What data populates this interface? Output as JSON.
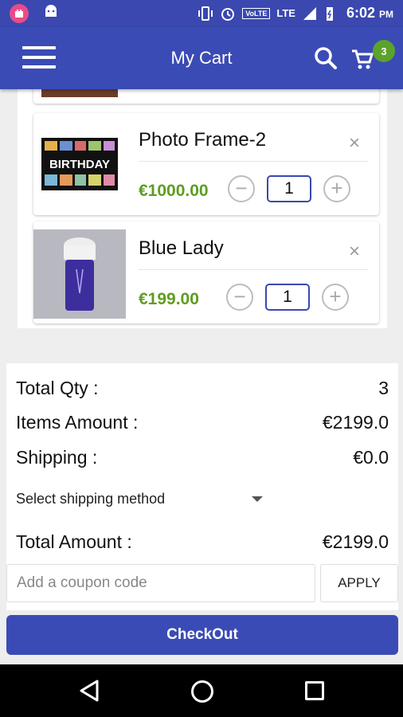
{
  "status_bar": {
    "network": "LTE",
    "volte": "VoLTE",
    "time": "6:02",
    "ampm": "PM"
  },
  "toolbar": {
    "title": "My Cart",
    "cart_count": "3"
  },
  "items": [
    {
      "name": "Photo Frame-2",
      "price": "€1000.00",
      "qty": "1",
      "remove": "×",
      "minus": "−",
      "plus": "+",
      "thumb_text": "BIRTHDAY"
    },
    {
      "name": "Blue Lady",
      "price": "€199.00",
      "qty": "1",
      "remove": "×",
      "minus": "−",
      "plus": "+"
    }
  ],
  "summary": {
    "total_qty_label": "Total Qty :",
    "total_qty": "3",
    "items_amount_label": "Items Amount :",
    "items_amount": "€2199.0",
    "shipping_label": "Shipping :",
    "shipping": "€0.0",
    "shipping_method_placeholder": "Select shipping method",
    "total_amount_label": "Total Amount :",
    "total_amount": "€2199.0"
  },
  "coupon": {
    "placeholder": "Add a coupon code",
    "apply_label": "APPLY"
  },
  "checkout": {
    "label": "CheckOut"
  },
  "colors": {
    "primary": "#3b4bb5",
    "price": "#5e9d20",
    "badge": "#5ba32b"
  }
}
